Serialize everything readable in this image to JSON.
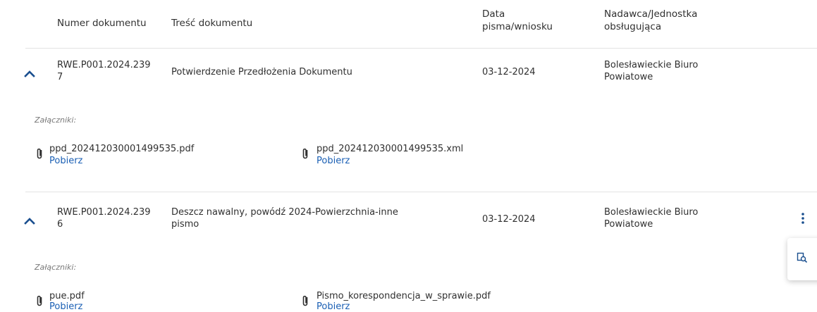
{
  "table": {
    "headers": {
      "number": "Numer dokumentu",
      "content": "Treść dokumentu",
      "date_line1": "Data",
      "date_line2": "pisma/wniosku",
      "sender_line1": "Nadawca/Jednostka",
      "sender_line2": "obsługująca"
    },
    "rows": [
      {
        "number_line1": "RWE.P001.2024.239",
        "number_line2": "7",
        "content_line1": "Potwierdzenie Przedłożenia Dokumentu",
        "content_line2": "",
        "date": "03-12-2024",
        "sender_line1": "Bolesławieckie Biuro",
        "sender_line2": "Powiatowe",
        "attachments_label": "Załączniki:",
        "attachments": [
          {
            "name": "ppd_202412030001499535.pdf",
            "link": "Pobierz"
          },
          {
            "name": "ppd_202412030001499535.xml",
            "link": "Pobierz"
          }
        ]
      },
      {
        "number_line1": "RWE.P001.2024.239",
        "number_line2": "6",
        "content_line1": "Deszcz nawalny, powódź 2024-Powierzchnia-inne",
        "content_line2": "pismo",
        "date": "03-12-2024",
        "sender_line1": "Bolesławieckie Biuro",
        "sender_line2": "Powiatowe",
        "attachments_label": "Załączniki:",
        "attachments": [
          {
            "name": "pue.pdf",
            "link": "Pobierz"
          },
          {
            "name": "Pismo_korespondencja_w_sprawie.pdf",
            "link": "Pobierz"
          }
        ]
      }
    ]
  },
  "icons": {
    "expand": "chevron-up-icon",
    "attachment": "paperclip-icon",
    "menu": "more-vertical-icon",
    "preview": "document-search-icon"
  },
  "colors": {
    "accent": "#1a5fb4",
    "text": "#303030",
    "muted": "#7a7a7a",
    "divider": "#e3e3e3"
  }
}
